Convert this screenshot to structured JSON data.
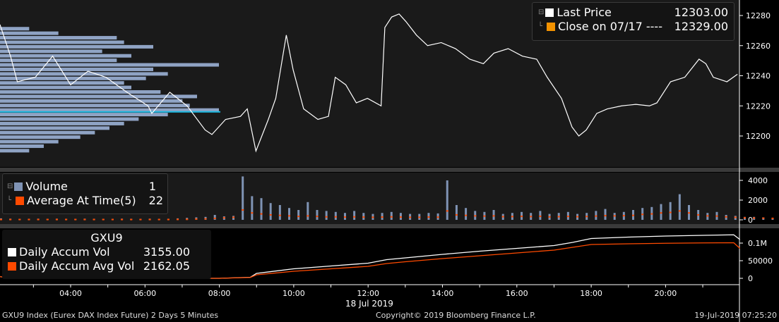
{
  "legend_price": {
    "items": [
      {
        "label": "Last Price",
        "value": "12303.00",
        "color": "#ffffff"
      },
      {
        "label": "Close on 07/17 ----",
        "value": "12329.00",
        "color": "#f39200"
      }
    ]
  },
  "legend_volume": {
    "items": [
      {
        "label": "Volume",
        "value": "1",
        "color": "#7f93b4"
      },
      {
        "label": "Average At Time(5)",
        "value": "22",
        "color": "#ff4a00"
      }
    ]
  },
  "legend_accum": {
    "title": "GXU9",
    "items": [
      {
        "label": "Daily Accum Vol",
        "value": "3155.00",
        "color": "#ffffff"
      },
      {
        "label": "Daily Accum Avg Vol",
        "value": "2162.05",
        "color": "#ff4a00"
      }
    ]
  },
  "footer": {
    "left": "GXU9 Index (Eurex DAX Index Future) 2 Days 5 Minutes",
    "center": "Copyright© 2019 Bloomberg Finance L.P.",
    "right": "19-Jul-2019 07:25:20",
    "date_label": "18 Jul 2019"
  },
  "chart_data": [
    {
      "type": "line",
      "title": "Last Price",
      "ylim": [
        12185,
        12290
      ],
      "yticks": [
        12200,
        12220,
        12240,
        12260,
        12280
      ],
      "x": [
        "02:06",
        "02:23",
        "02:34",
        "03:03",
        "03:31",
        "04:00",
        "04:28",
        "04:57",
        "05:31",
        "06:05",
        "06:11",
        "06:40",
        "07:08",
        "07:37",
        "07:48",
        "08:10",
        "08:34",
        "08:45",
        "08:59",
        "09:19",
        "09:31",
        "09:48",
        "09:59",
        "10:16",
        "10:39",
        "10:56",
        "11:07",
        "11:24",
        "11:41",
        "11:59",
        "12:21",
        "12:27",
        "12:38",
        "12:50",
        "13:01",
        "13:18",
        "13:36",
        "13:58",
        "14:21",
        "14:44",
        "15:06",
        "15:23",
        "15:46",
        "16:09",
        "16:32",
        "16:49",
        "17:12",
        "17:29",
        "17:40",
        "17:52",
        "18:09",
        "18:26",
        "18:49",
        "19:12",
        "19:34",
        "19:46",
        "20:08",
        "20:31",
        "20:54",
        "21:05",
        "21:17",
        "21:39",
        "21:56"
      ],
      "y": [
        12274,
        12253,
        12236,
        12239,
        12253,
        12234,
        12243,
        12239,
        12229,
        12220,
        12215,
        12229,
        12220,
        12204,
        12201,
        12211,
        12213,
        12218,
        12190,
        12211,
        12225,
        12267,
        12244,
        12218,
        12211,
        12213,
        12239,
        12234,
        12222,
        12225,
        12220,
        12272,
        12279,
        12281,
        12276,
        12267,
        12260,
        12262,
        12258,
        12251,
        12248,
        12255,
        12258,
        12253,
        12251,
        12239,
        12225,
        12206,
        12200,
        12204,
        12215,
        12218,
        12220,
        12221,
        12220,
        12222,
        12236,
        12239,
        12251,
        12248,
        12239,
        12236,
        12241
      ],
      "profile": {
        "prices": [
          12190,
          12193,
          12196,
          12199,
          12202,
          12205,
          12208,
          12211,
          12214,
          12217,
          12220,
          12223,
          12226,
          12229,
          12232,
          12235,
          12238,
          12241,
          12244,
          12247,
          12250,
          12253,
          12256,
          12259,
          12262,
          12265,
          12268,
          12271
        ],
        "volumes": [
          40,
          60,
          80,
          110,
          130,
          150,
          170,
          190,
          230,
          300,
          260,
          250,
          270,
          220,
          180,
          170,
          200,
          230,
          210,
          300,
          160,
          180,
          140,
          210,
          170,
          160,
          80,
          40
        ]
      },
      "reference_line": 12216
    },
    {
      "type": "bar",
      "title": "Volume",
      "ylim": [
        0,
        4500
      ],
      "yticks": [
        0,
        2000,
        4000
      ],
      "start": "02:06",
      "interval_min": 15,
      "values": [
        150,
        120,
        100,
        110,
        120,
        100,
        120,
        110,
        100,
        120,
        110,
        100,
        100,
        120,
        110,
        100,
        120,
        100,
        110,
        150,
        200,
        250,
        300,
        500,
        350,
        400,
        4400,
        2400,
        2200,
        1700,
        1500,
        1200,
        1000,
        1800,
        1000,
        900,
        800,
        700,
        900,
        700,
        600,
        700,
        800,
        700,
        600,
        600,
        700,
        650,
        4000,
        1500,
        1200,
        900,
        800,
        1000,
        600,
        700,
        800,
        700,
        900,
        600,
        700,
        800,
        600,
        700,
        900,
        1100,
        700,
        800,
        1000,
        1200,
        1300,
        1600,
        1800,
        2600,
        1500,
        1000,
        700,
        800,
        500,
        400,
        300,
        300,
        250,
        200,
        150,
        200,
        150,
        200,
        200,
        150,
        300,
        200
      ],
      "avg": [
        30,
        30,
        30,
        30,
        30,
        30,
        30,
        30,
        30,
        30,
        30,
        30,
        30,
        30,
        30,
        30,
        30,
        30,
        30,
        40,
        50,
        80,
        100,
        150,
        200,
        250,
        1000,
        700,
        600,
        500,
        450,
        400,
        350,
        400,
        350,
        300,
        300,
        280,
        300,
        280,
        260,
        280,
        300,
        280,
        260,
        260,
        280,
        270,
        900,
        500,
        450,
        400,
        380,
        400,
        320,
        330,
        350,
        330,
        360,
        300,
        320,
        350,
        320,
        340,
        380,
        420,
        400,
        420,
        450,
        550,
        600,
        700,
        750,
        900,
        700,
        500,
        400,
        380,
        300,
        250,
        200,
        180,
        170,
        150,
        130,
        140,
        120,
        130,
        130,
        120,
        150,
        130
      ]
    },
    {
      "type": "line",
      "title": "Daily Accum",
      "ylim": [
        0,
        130000
      ],
      "yticks": [
        "0",
        "50000",
        "0.1M"
      ],
      "x": [
        "02:06",
        "02:20",
        "08:00",
        "08:50",
        "09:00",
        "10:00",
        "11:00",
        "12:00",
        "12:30",
        "13:00",
        "14:00",
        "15:00",
        "16:00",
        "17:00",
        "17:30",
        "18:00",
        "19:00",
        "20:00",
        "21:00",
        "21:50",
        "22:00"
      ],
      "series": [
        {
          "name": "Daily Accum Vol",
          "values": [
            5000,
            0,
            0,
            3000,
            14000,
            27000,
            35000,
            43000,
            53000,
            58000,
            68000,
            77000,
            85000,
            93000,
            102000,
            113000,
            117000,
            120000,
            122000,
            123500,
            110000
          ]
        },
        {
          "name": "Daily Accum Avg Vol",
          "values": [
            5000,
            0,
            0,
            2500,
            10000,
            20000,
            27000,
            34000,
            42000,
            47000,
            56000,
            64000,
            72000,
            80000,
            88000,
            96000,
            98000,
            99500,
            100500,
            101000,
            85000
          ]
        }
      ]
    },
    {
      "type": "axis",
      "xticks": [
        "04:00",
        "06:00",
        "08:00",
        "10:00",
        "12:00",
        "14:00",
        "16:00",
        "18:00",
        "20:00"
      ]
    }
  ]
}
